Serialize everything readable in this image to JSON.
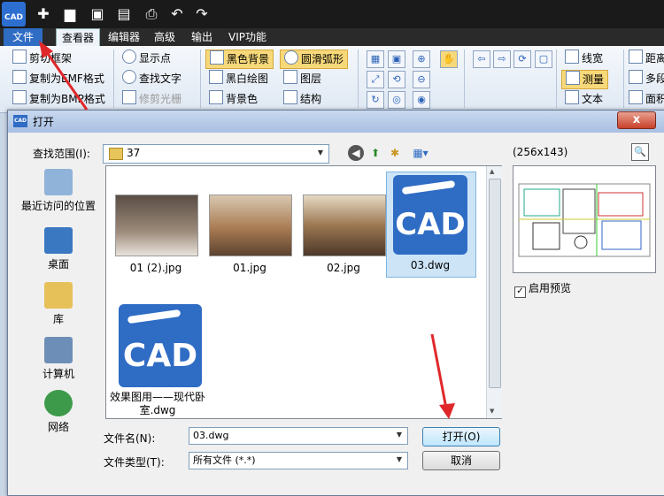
{
  "app": {
    "menu": [
      "文件",
      "查看器",
      "编辑器",
      "高级",
      "输出",
      "VIP功能"
    ],
    "ribbon": {
      "col1": [
        "剪切框架",
        "复制为EMF格式",
        "复制为BMP格式"
      ],
      "col2": [
        "显示点",
        "查找文字",
        "修剪光栅"
      ],
      "col3": [
        "黑色背景",
        "黑白绘图",
        "背景色"
      ],
      "col4": [
        "圆滑弧形",
        "图层",
        "结构"
      ],
      "col6": [
        "线宽",
        "测量",
        "文本"
      ],
      "col7": [
        "距离",
        "多段",
        "面积"
      ]
    },
    "logo_text": "CAD"
  },
  "dialog": {
    "title": "打开",
    "close": "x",
    "look_in_label": "查找范围(I):",
    "look_in_value": "37",
    "places": [
      "最近访问的位置",
      "桌面",
      "库",
      "计算机",
      "网络"
    ],
    "files": [
      {
        "name": "01 (2).jpg"
      },
      {
        "name": "01.jpg"
      },
      {
        "name": "02.jpg"
      },
      {
        "name": "03.dwg",
        "selected": true,
        "icon_text": "CAD"
      },
      {
        "name": "效果图用——现代卧室.dwg",
        "icon_text": "CAD"
      }
    ],
    "preview_size": "(256x143)",
    "enable_preview": "启用预览",
    "filename_label": "文件名(N):",
    "filename_value": "03.dwg",
    "filetype_label": "文件类型(T):",
    "filetype_value": "所有文件 (*.*)",
    "open_button": "打开(O)",
    "cancel_button": "取消"
  },
  "colors": {
    "accent": "#2f6cc4",
    "arrow": "#e0282a"
  }
}
